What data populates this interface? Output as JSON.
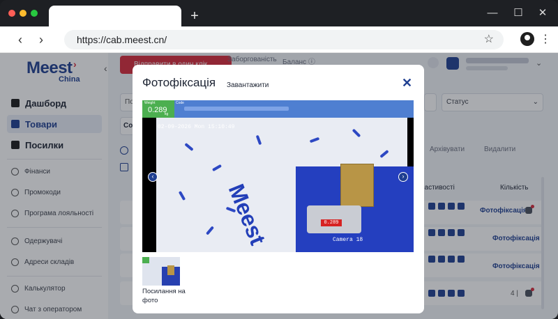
{
  "browser": {
    "dot_colors": [
      "#ff5f57",
      "#febc2e",
      "#28c840"
    ],
    "new_tab": "+",
    "minimize": "—",
    "maximize": "☐",
    "close": "✕",
    "back": "‹",
    "forward": "›",
    "url": "https://cab.meest.cn/",
    "star": "☆",
    "menu": "⋮"
  },
  "logo": {
    "brand": "Meest",
    "sub": "China"
  },
  "sidebar": {
    "collapse": "‹",
    "main_items": [
      {
        "label": "Дашборд",
        "icon": "dashboard-icon"
      },
      {
        "label": "Товари",
        "icon": "goods-icon"
      },
      {
        "label": "Посилки",
        "icon": "parcel-icon"
      }
    ],
    "items": [
      {
        "label": "Фінанси",
        "icon": "finance-icon"
      },
      {
        "label": "Промокоди",
        "icon": "promo-icon"
      },
      {
        "label": "Програма лояльності",
        "icon": "loyalty-icon"
      },
      {
        "label": "Одержувачі",
        "icon": "recipients-icon"
      },
      {
        "label": "Адреси складів",
        "icon": "location-icon"
      },
      {
        "label": "Калькулятор",
        "icon": "calculator-icon"
      },
      {
        "label": "Чат з оператором",
        "icon": "chat-icon"
      }
    ]
  },
  "header": {
    "send_button": "Відправити в один клік",
    "debt": "Заборгованість",
    "balance": "Баланс ⓘ",
    "chevron": "⌄"
  },
  "filters": {
    "search_placeholder": "По",
    "status_label": "Статус",
    "status_chevron": "⌄",
    "sort_label": "Сор"
  },
  "actions": {
    "archive": "Архівувати",
    "delete": "Видалити"
  },
  "table": {
    "col_properties": "Властивості",
    "col_quantity": "Кількість",
    "rows": [
      {
        "link": "Фотофіксація",
        "qty": ""
      },
      {
        "link": "Фотофіксація",
        "qty": ""
      },
      {
        "link": "Фотофіксація",
        "qty": ""
      },
      {
        "link": "",
        "qty": "4 |"
      }
    ]
  },
  "modal": {
    "title": "Фотофіксація",
    "download": "Завантажити",
    "close": "✕",
    "weight_label": "Weight",
    "weight_value": "0.289",
    "weight_unit": "kg",
    "code_label": "Code",
    "camera_timestamp": "02-09-2026 Mon 15:10:49",
    "camera_name": "Camera 18",
    "scale_display": "0.289",
    "wall_brand": "Meest",
    "prev": "‹",
    "next": "›",
    "thumb_caption": "Посилання на фото"
  }
}
